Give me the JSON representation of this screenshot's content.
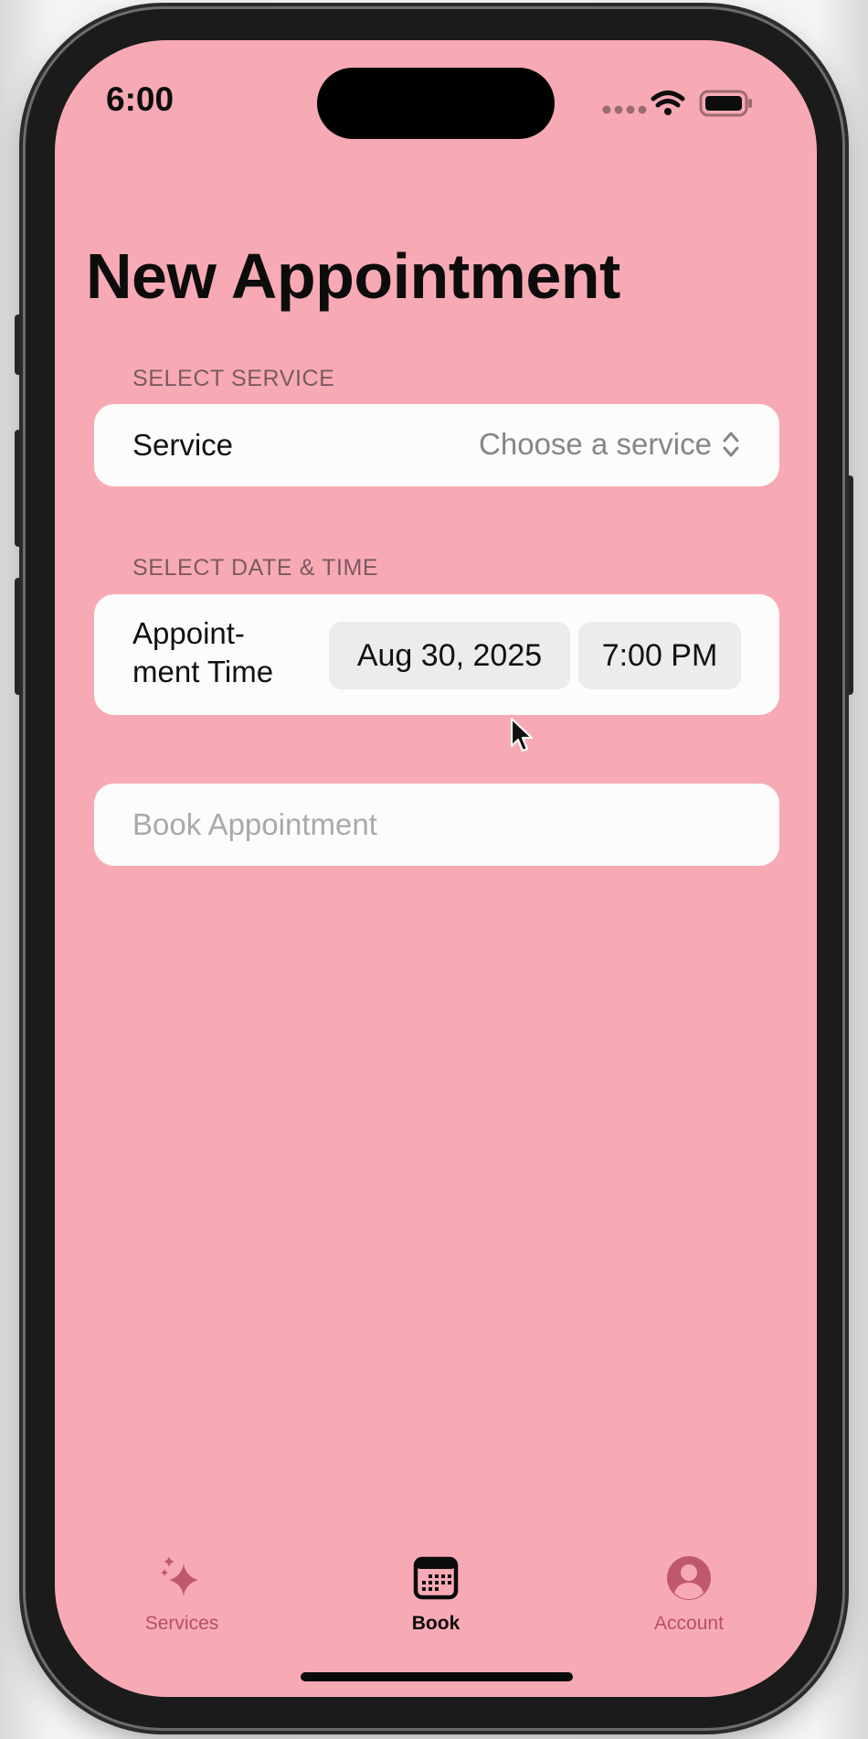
{
  "status_bar": {
    "time": "6:00"
  },
  "page": {
    "title": "New Appointment"
  },
  "service_section": {
    "header": "SELECT SERVICE",
    "row_label": "Service",
    "picker_value": "Choose a service",
    "picker_icon": "chevron-up-down-icon"
  },
  "datetime_section": {
    "header": "SELECT DATE & TIME",
    "row_label": "Appoint-\nment Time",
    "date_value": "Aug 30, 2025",
    "time_value": "7:00 PM"
  },
  "book_button": {
    "label": "Book Appointment"
  },
  "tab_bar": {
    "tabs": [
      {
        "label": "Services",
        "icon": "sparkles-icon",
        "selected": false
      },
      {
        "label": "Book",
        "icon": "calendar-icon",
        "selected": true
      },
      {
        "label": "Account",
        "icon": "person-circle-icon",
        "selected": false
      }
    ]
  },
  "colors": {
    "background": "#f8aab4",
    "accent": "#b84f63",
    "card": "#fcfcfc",
    "pill": "#ececec",
    "selected_tab": "#0b0b0b"
  }
}
